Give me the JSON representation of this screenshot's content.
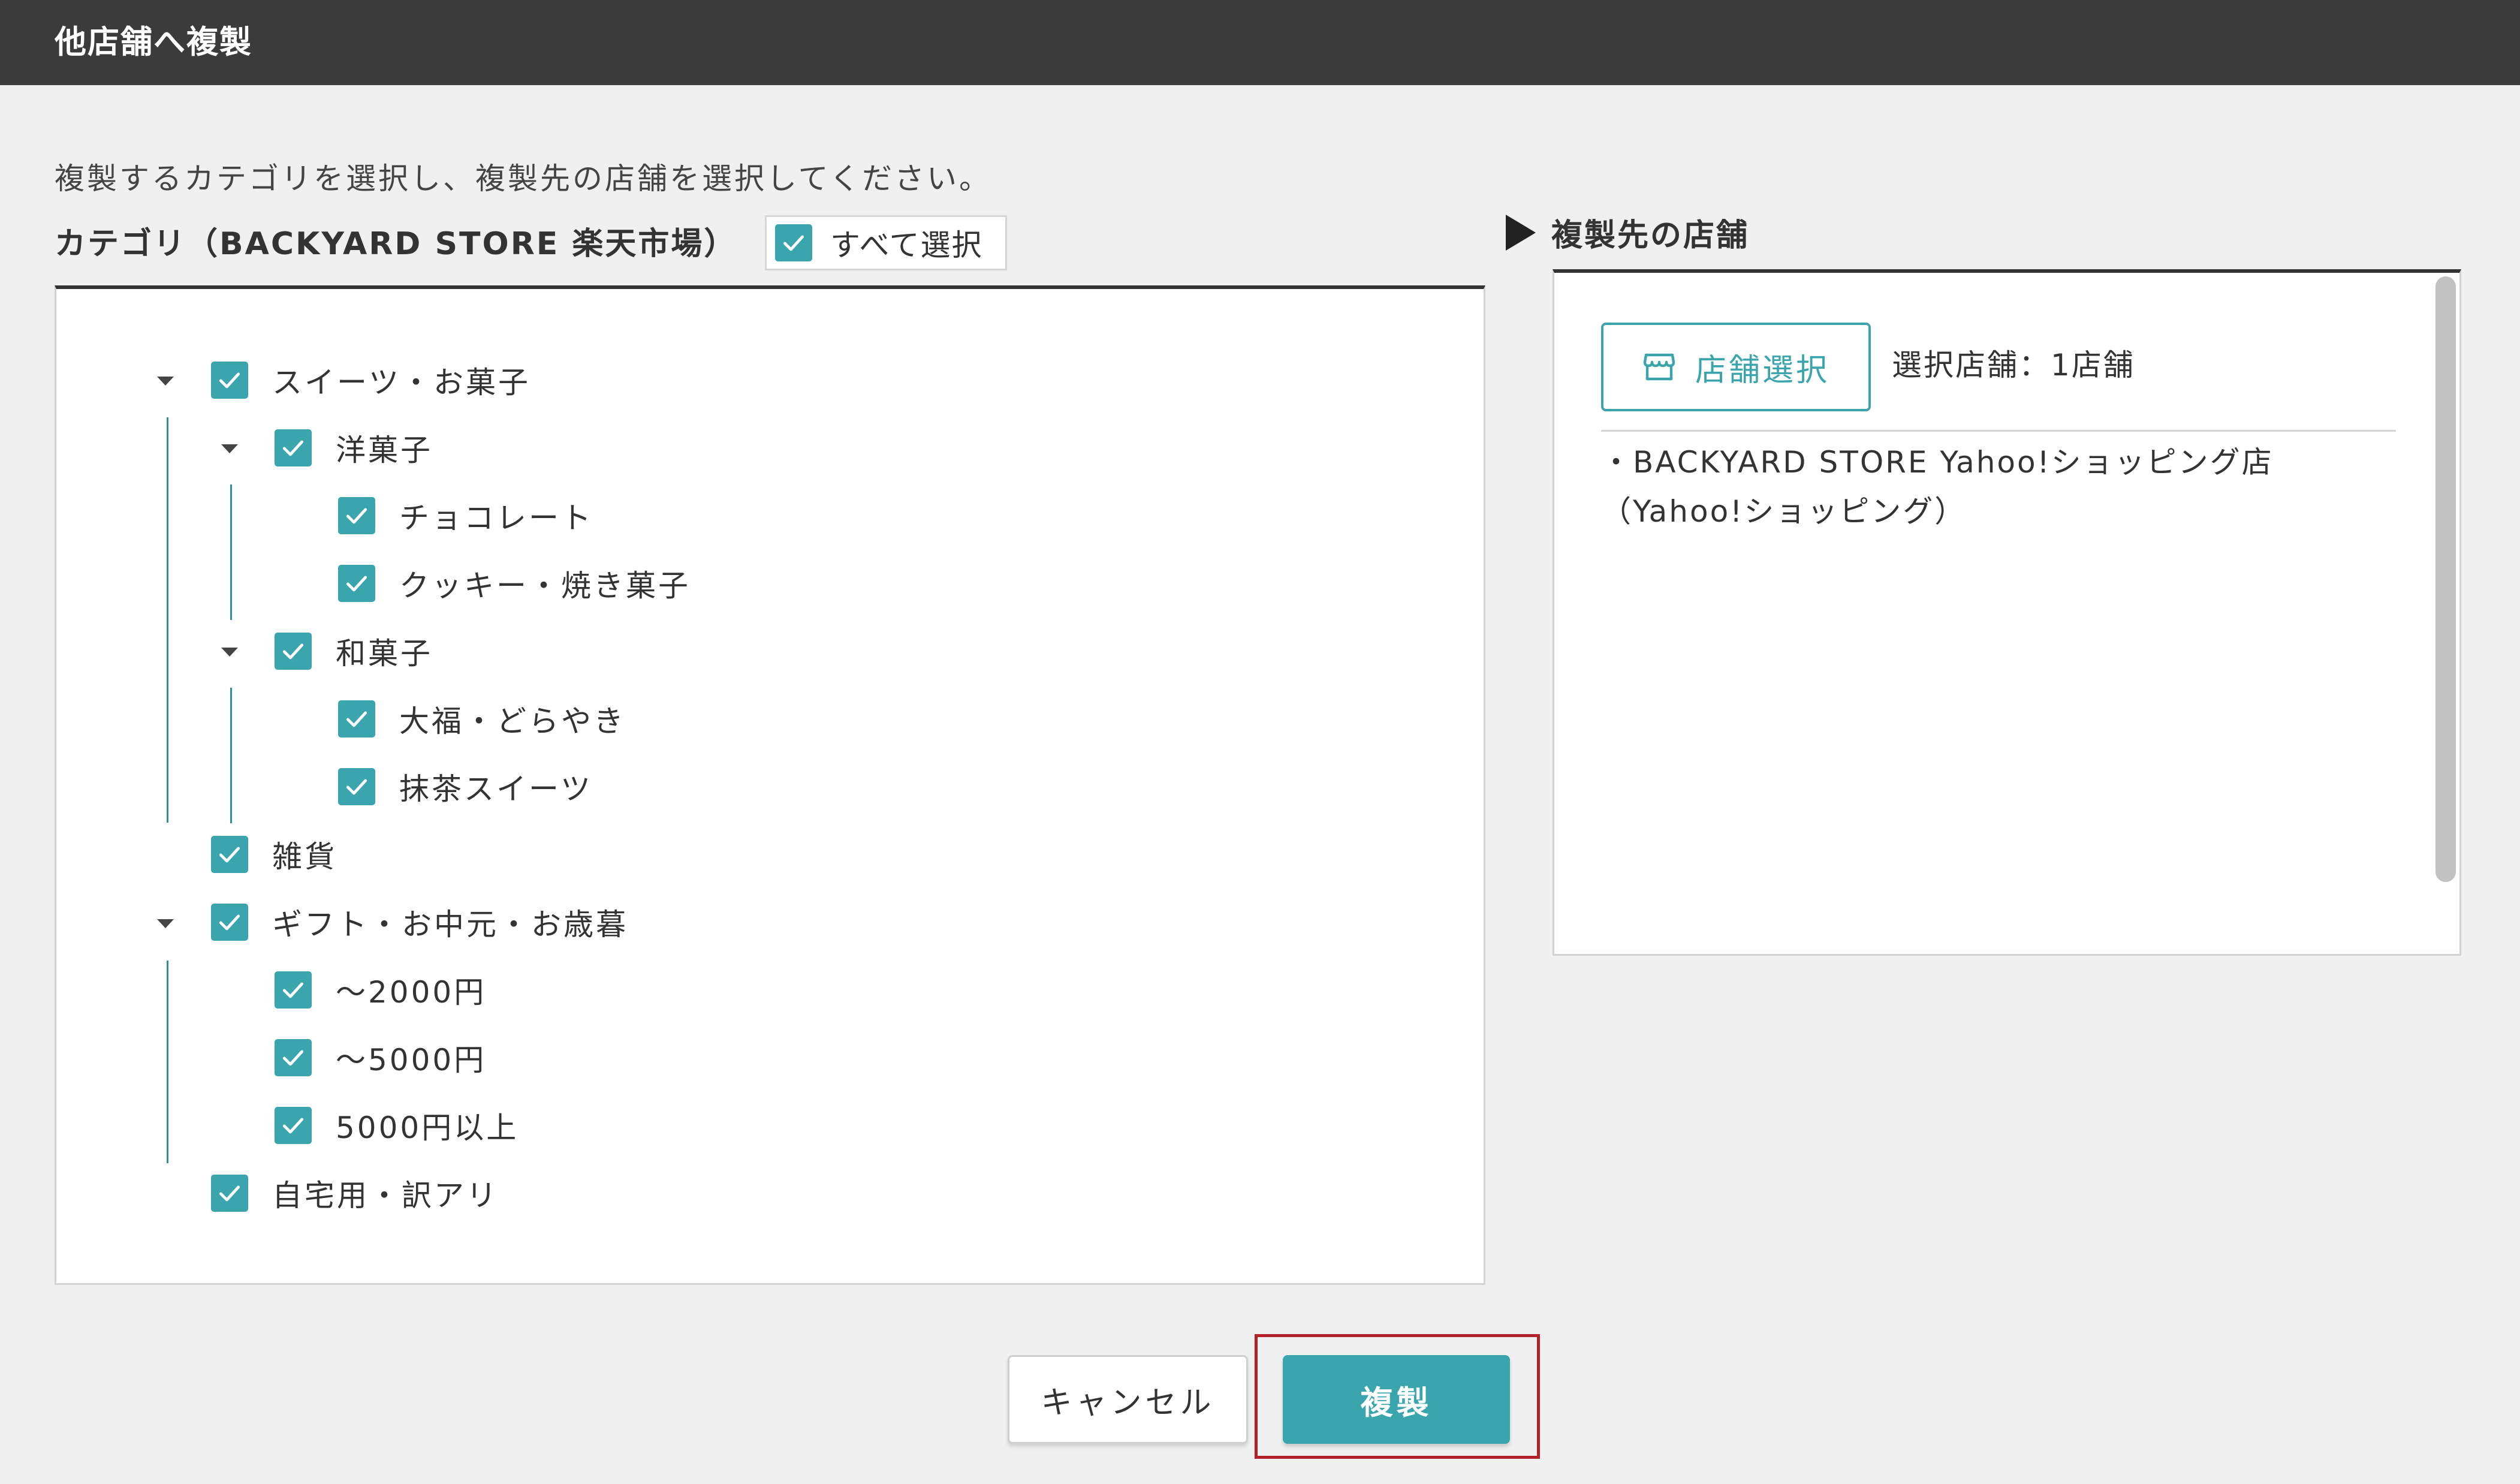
{
  "dialog": {
    "title": "他店舗へ複製",
    "instruction": "複製するカテゴリを選択し、複製先の店舗を選択してください。"
  },
  "categories": {
    "heading": "カテゴリ（BACKYARD STORE 楽天市場）",
    "select_all_label": "すべて選択",
    "select_all_checked": true,
    "tree": [
      {
        "label": "スイーツ・お菓子",
        "checked": true,
        "expanded": true
      },
      {
        "label": "洋菓子",
        "checked": true,
        "expanded": true
      },
      {
        "label": "チョコレート",
        "checked": true
      },
      {
        "label": "クッキー・焼き菓子",
        "checked": true
      },
      {
        "label": "和菓子",
        "checked": true,
        "expanded": true
      },
      {
        "label": "大福・どらやき",
        "checked": true
      },
      {
        "label": "抹茶スイーツ",
        "checked": true
      },
      {
        "label": "雑貨",
        "checked": true
      },
      {
        "label": "ギフト・お中元・お歳暮",
        "checked": true,
        "expanded": true
      },
      {
        "label": "～2000円",
        "checked": true
      },
      {
        "label": "～5000円",
        "checked": true
      },
      {
        "label": "5000円以上",
        "checked": true
      },
      {
        "label": "自宅用・訳アリ",
        "checked": true
      }
    ]
  },
  "stores": {
    "heading": "複製先の店舗",
    "select_button_label": "店舗選択",
    "selected_count_text": "選択店舗：1店舗",
    "selected_items": [
      "・BACKYARD STORE Yahoo!ショッピング店（Yahoo!ショッピング）"
    ]
  },
  "footer": {
    "cancel_label": "キャンセル",
    "copy_label": "複製"
  },
  "colors": {
    "accent": "#3aa5ad",
    "titlebar": "#3b3b3b",
    "highlight": "#b3202a"
  }
}
